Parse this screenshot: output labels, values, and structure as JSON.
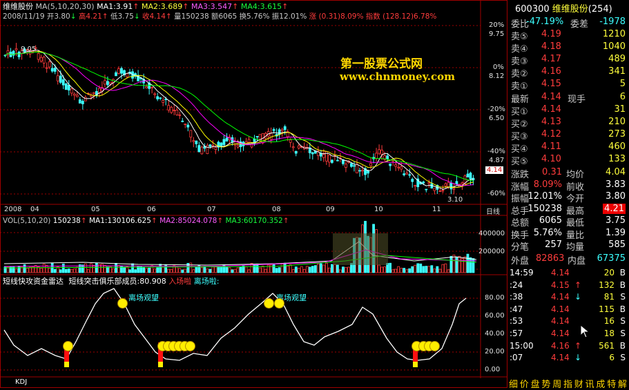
{
  "chart_header": {
    "stock_name": "维维股份",
    "ma_label": "MA(5,10,20,30)",
    "ma1": "MA1:3.91",
    "ma2": "MA2:3.689",
    "ma3": "MA3:3.547",
    "ma4": "MA4:3.615",
    "line2": "2008/11/19 开3.80",
    "high": "高4.21",
    "low": "低3.75",
    "close": "收4.14",
    "volume": "量150238",
    "amount": "额6065",
    "turnover": "换5.76%",
    "amplitude": "振12.01%",
    "change": "涨 (0.31)8.09%",
    "index": "指数 (128.12)6.78%"
  },
  "watermark": {
    "title": "第一股票公式网",
    "url": "www.chnmoney.com"
  },
  "price_axis": {
    "pct": [
      "20%",
      "0%",
      "-20%",
      "-40%",
      "-60%"
    ],
    "prices": [
      "9.75",
      "8.12",
      "6.50",
      "4.87"
    ],
    "current": "4.14",
    "max_label": "9.05",
    "min_label": "3.10"
  },
  "time_axis": [
    "2008",
    "04",
    "05",
    "06",
    "07",
    "08",
    "09",
    "10",
    "11"
  ],
  "period_label": "日线",
  "volume_header": {
    "label": "VOL(5,10,20)",
    "value": "150238",
    "ma1": "MA1:130106.625",
    "ma2": "MA2:85024.078",
    "ma3": "MA3:60170.352"
  },
  "volume_axis": [
    "400000",
    "200000"
  ],
  "indicator_header": {
    "name": "短线快攻资金雷达",
    "member": "短线突击俱乐部成员:80.908",
    "enter": "入场啦",
    "exit": "离场啦:"
  },
  "indicator_axis": [
    "80.00",
    "60.00",
    "40.00",
    "20.00",
    "0.00"
  ],
  "indicator_labels": {
    "leave": "离场观望"
  },
  "bottom_tab": "KDJ",
  "quote": {
    "code": "600300",
    "name": "维维股份",
    "count": "(254)",
    "weibi_label": "委比",
    "weibi": "-47.19%",
    "weicha_label": "委差",
    "weicha": "-1978",
    "asks": [
      {
        "label": "卖⑤",
        "price": "4.19",
        "vol": "1210"
      },
      {
        "label": "卖④",
        "price": "4.18",
        "vol": "1040"
      },
      {
        "label": "卖③",
        "price": "4.17",
        "vol": "489"
      },
      {
        "label": "卖②",
        "price": "4.16",
        "vol": "341"
      },
      {
        "label": "卖①",
        "price": "4.15",
        "vol": "5"
      }
    ],
    "last_label": "最新",
    "last": "4.14",
    "hand_label": "现手",
    "hand": "6",
    "bids": [
      {
        "label": "买①",
        "price": "4.14",
        "vol": "31"
      },
      {
        "label": "买②",
        "price": "4.13",
        "vol": "210"
      },
      {
        "label": "买③",
        "price": "4.12",
        "vol": "273"
      },
      {
        "label": "买④",
        "price": "4.11",
        "vol": "460"
      },
      {
        "label": "买⑤",
        "price": "4.10",
        "vol": "133"
      }
    ],
    "stats": [
      {
        "l1": "涨跌",
        "v1": "0.31",
        "l2": "均价",
        "v2": "4.04"
      },
      {
        "l1": "涨幅",
        "v1": "8.09%",
        "l2": "前收",
        "v2": "3.83"
      },
      {
        "l1": "振幅",
        "v1": "12.01%",
        "l2": "今开",
        "v2": "3.80"
      },
      {
        "l1": "总手",
        "v1": "150238",
        "l2": "最高",
        "v2": "4.21"
      },
      {
        "l1": "总额",
        "v1": "6065",
        "l2": "最低",
        "v2": "3.75"
      },
      {
        "l1": "换手",
        "v1": "5.76%",
        "l2": "量比",
        "v2": "1.39"
      },
      {
        "l1": "分笔",
        "v1": "257",
        "l2": "均量",
        "v2": "585"
      }
    ],
    "outer_label": "外盘",
    "outer": "82863",
    "inner_label": "内盘",
    "inner": "67375"
  },
  "trades": [
    {
      "time": "14:59",
      "price": "4.14",
      "arrow": "",
      "vol": "20",
      "side": "B"
    },
    {
      "time": ":24",
      "price": "4.15",
      "arrow": "↑",
      "vol": "132",
      "side": "B"
    },
    {
      "time": ":38",
      "price": "4.14",
      "arrow": "↓",
      "vol": "81",
      "side": "S"
    },
    {
      "time": ":47",
      "price": "4.14",
      "arrow": "",
      "vol": "115",
      "side": "B"
    },
    {
      "time": ":53",
      "price": "4.14",
      "arrow": "",
      "vol": "16",
      "side": "S"
    },
    {
      "time": ":57",
      "price": "4.14",
      "arrow": "",
      "vol": "18",
      "side": "S"
    },
    {
      "time": "15:00",
      "price": "4.16",
      "arrow": "↑",
      "vol": "561",
      "side": "B"
    },
    {
      "time": ":07",
      "price": "4.14",
      "arrow": "↓",
      "vol": "6",
      "side": "S"
    }
  ],
  "bottom_tabs": [
    "细",
    "价",
    "盘",
    "势",
    "周",
    "指",
    "财",
    "讯",
    "成",
    "特",
    "解"
  ],
  "colors": {
    "up": "#ff3c3c",
    "down": "#3cffff",
    "ma5": "#ffffff",
    "ma10": "#ffff00",
    "ma20": "#ff00ff",
    "ma30": "#00ff00"
  }
}
